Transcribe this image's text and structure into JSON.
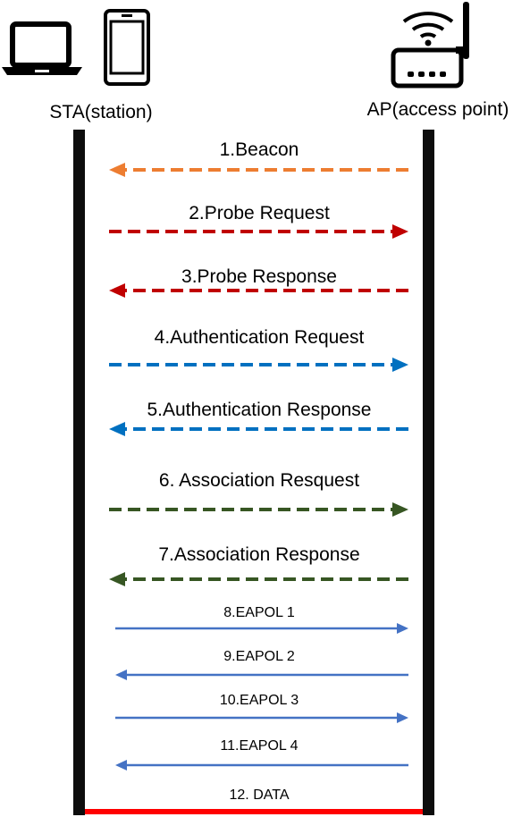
{
  "actors": {
    "sta": {
      "label": "STA(station)",
      "icons": [
        "laptop-icon",
        "smartphone-icon"
      ]
    },
    "ap": {
      "label": "AP(access point)",
      "icons": [
        "wifi-router-icon"
      ]
    }
  },
  "messages": [
    {
      "index": 1,
      "label": "1.Beacon",
      "direction": "ap-to-sta",
      "line": "dashed",
      "color": "#ED7D31"
    },
    {
      "index": 2,
      "label": "2.Probe Request",
      "direction": "sta-to-ap",
      "line": "dashed",
      "color": "#C00000"
    },
    {
      "index": 3,
      "label": "3.Probe Response",
      "direction": "ap-to-sta",
      "line": "dashed",
      "color": "#C00000"
    },
    {
      "index": 4,
      "label": "4.Authentication Request",
      "direction": "sta-to-ap",
      "line": "dashed",
      "color": "#0070C0"
    },
    {
      "index": 5,
      "label": "5.Authentication Response",
      "direction": "ap-to-sta",
      "line": "dashed",
      "color": "#0070C0"
    },
    {
      "index": 6,
      "label": "6. Association Resquest",
      "direction": "sta-to-ap",
      "line": "dashed",
      "color": "#375623"
    },
    {
      "index": 7,
      "label": "7.Association Response",
      "direction": "ap-to-sta",
      "line": "dashed",
      "color": "#375623"
    },
    {
      "index": 8,
      "label": "8.EAPOL 1",
      "direction": "sta-to-ap",
      "line": "solid",
      "color": "#4472C4"
    },
    {
      "index": 9,
      "label": "9.EAPOL 2",
      "direction": "ap-to-sta",
      "line": "solid",
      "color": "#4472C4"
    },
    {
      "index": 10,
      "label": "10.EAPOL 3",
      "direction": "sta-to-ap",
      "line": "solid",
      "color": "#4472C4"
    },
    {
      "index": 11,
      "label": "11.EAPOL 4",
      "direction": "ap-to-sta",
      "line": "solid",
      "color": "#4472C4"
    },
    {
      "index": 12,
      "label": "12. DATA",
      "direction": "bidirectional",
      "line": "bar",
      "color": "#FF0000"
    }
  ],
  "colors": {
    "lifeline": "#0D0D0D",
    "icon": "#000000"
  }
}
